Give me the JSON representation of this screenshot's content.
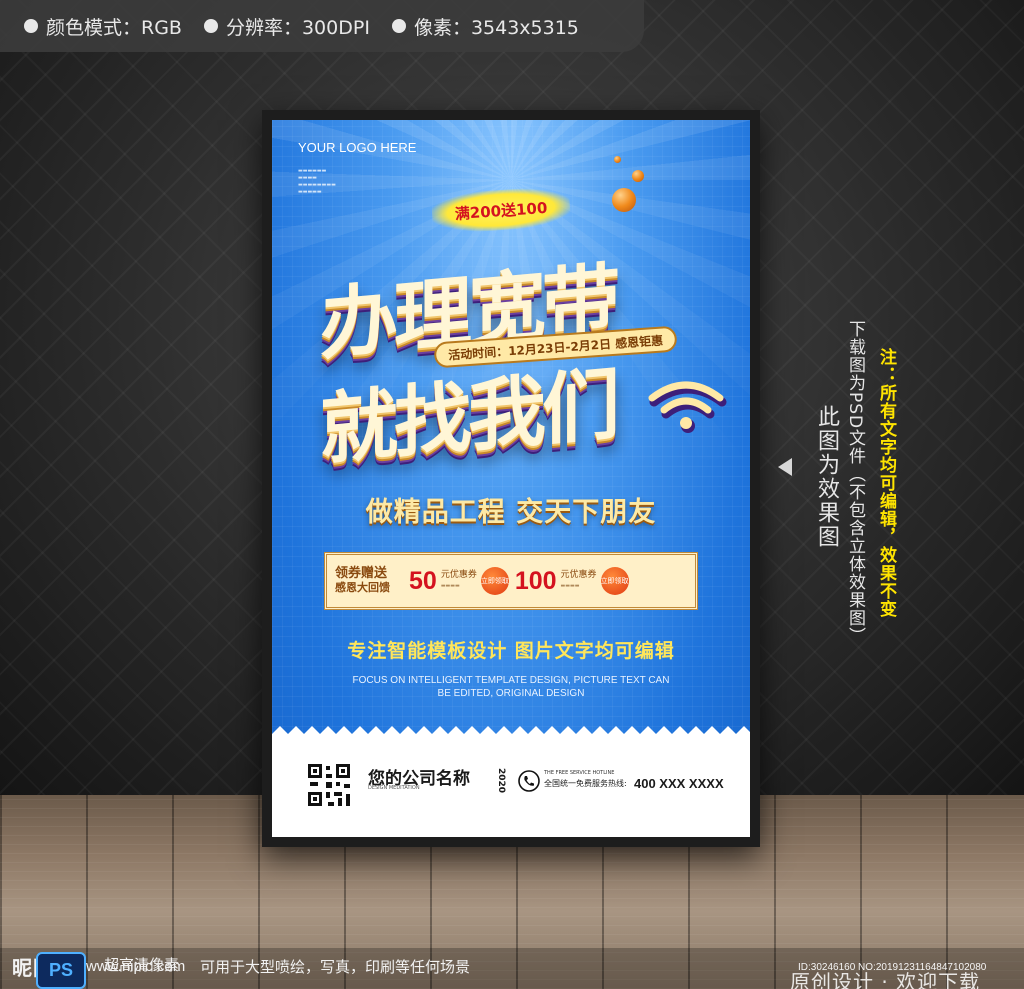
{
  "info_bar": {
    "color_mode": "颜色模式：RGB",
    "resolution": "分辨率：300DPI",
    "pixels": "像素：3543x5315"
  },
  "poster": {
    "logo": "YOUR LOGO HERE",
    "promo_badge": "满200送100",
    "headline_line1": "办理宽带",
    "headline_line2": "就找我们",
    "activity_time": "活动时间：12月23日-2月2日 感恩钜惠",
    "slogan": "做精品工程  交天下朋友",
    "coupon_bar": {
      "label_line1": "领券赠送",
      "label_line2": "感恩大回馈",
      "coupons": [
        {
          "amount": "50",
          "text": "元优惠券",
          "button": "立即领取"
        },
        {
          "amount": "100",
          "text": "元优惠券",
          "button": "立即领取"
        }
      ]
    },
    "subheadline": "专注智能模板设计 图片文字均可编辑",
    "english_line1": "FOCUS ON INTELLIGENT TEMPLATE DESIGN, PICTURE TEXT CAN",
    "english_line2": "BE EDITED, ORIGINAL DESIGN",
    "footer": {
      "company_name": "您的公司名称",
      "year": "2020",
      "design_label": "DESIGN MEDITATION",
      "hotline_en": "THE FREE SERVICE HOTLINE",
      "hotline_label": "全国统一免费服务热线:",
      "phone": "400 XXX XXXX"
    }
  },
  "side_notes": {
    "preview_note": "此图为效果图",
    "psd_note": "下载图为PSD文件（不包含立体效果图）",
    "tip": "注：所有文字均可编辑，效果不变"
  },
  "watermark": {
    "brand": "昵图网",
    "ps_label": "PS",
    "url": "www.nipic.com",
    "hd": "超高清像素",
    "usage": "可用于大型喷绘，写真，印刷等任何场景",
    "id_line": "ID:30246160 NO:20191231164847102080",
    "original": "原创设计 · 欢迎下载"
  },
  "colors": {
    "poster_blue": "#1f74dc",
    "headline_cream": "#fff6d6",
    "accent_yellow": "#ffe65a",
    "coupon_red": "#d4121f",
    "tip_yellow": "#ffe400"
  }
}
